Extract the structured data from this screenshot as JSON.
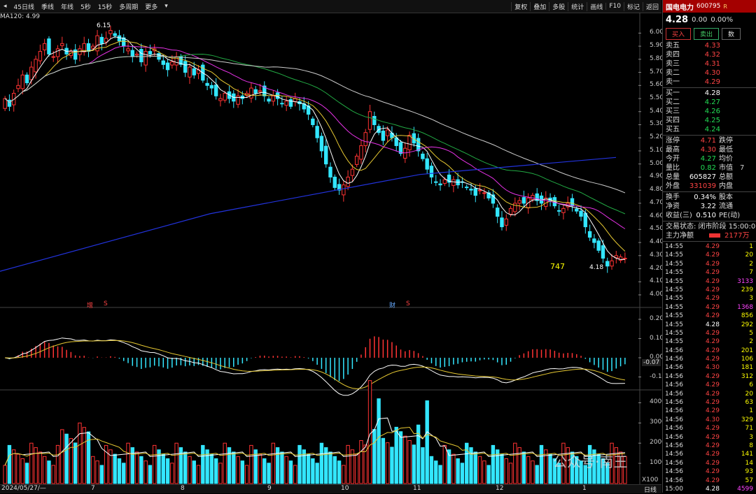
{
  "toolbar": {
    "tabs": [
      "45日线",
      "季线",
      "年线",
      "5秒",
      "15秒",
      "多周期",
      "更多"
    ],
    "tools": [
      "复权",
      "叠加",
      "多股",
      "统计",
      "画线",
      "F10",
      "标记",
      "返回"
    ],
    "nav_icons": [
      "back-icon",
      "forward-icon"
    ]
  },
  "ma_legend": {
    "ma120": "MA120: 4.99"
  },
  "chart_data": [
    {
      "type": "candlestick",
      "title": "",
      "y_ticks": [
        "6.00",
        "5.90",
        "5.80",
        "5.70",
        "5.60",
        "5.50",
        "5.40",
        "5.30",
        "5.20",
        "5.10",
        "5.00",
        "4.90",
        "4.80",
        "4.70",
        "4.60",
        "4.50",
        "4.40",
        "4.30",
        "4.20",
        "4.10",
        "4.00"
      ],
      "ylim": [
        4.0,
        6.05
      ],
      "x_ticks": [
        "7",
        "8",
        "9",
        "10",
        "11",
        "12",
        "1"
      ],
      "start_date": "2024/05/27/—",
      "annotations": {
        "high": "6.15",
        "low": "4.18",
        "count": "747",
        "tag_a": "增",
        "tag_b": "财",
        "tag_c": "S",
        "tag_d": "S"
      },
      "closes": [
        5.5,
        5.44,
        5.54,
        5.6,
        5.68,
        5.62,
        5.74,
        5.8,
        5.86,
        5.92,
        5.84,
        5.82,
        5.88,
        5.92,
        5.84,
        5.86,
        5.8,
        5.88,
        5.92,
        5.86,
        5.9,
        5.98,
        5.92,
        5.96,
        6.02,
        5.98,
        5.94,
        5.9,
        5.88,
        5.82,
        5.84,
        5.78,
        5.86,
        5.84,
        5.88,
        5.8,
        5.76,
        5.72,
        5.78,
        5.82,
        5.76,
        5.7,
        5.74,
        5.68,
        5.72,
        5.64,
        5.6,
        5.58,
        5.52,
        5.5,
        5.54,
        5.5,
        5.48,
        5.52,
        5.5,
        5.54,
        5.58,
        5.54,
        5.56,
        5.52,
        5.48,
        5.52,
        5.5,
        5.46,
        5.48,
        5.44,
        5.5,
        5.46,
        5.42,
        5.38,
        5.3,
        5.2,
        5.1,
        5.0,
        4.9,
        4.82,
        4.8,
        4.84,
        4.9,
        4.96,
        5.06,
        5.14,
        5.24,
        5.4,
        5.3,
        5.24,
        5.18,
        5.26,
        5.2,
        5.14,
        5.08,
        5.12,
        5.22,
        5.16,
        5.1,
        5.04,
        4.96,
        4.9,
        4.86,
        4.84,
        4.88,
        4.86,
        4.88,
        4.84,
        4.86,
        4.82,
        4.8,
        4.76,
        4.8,
        4.78,
        4.74,
        4.7,
        4.6,
        4.52,
        4.58,
        4.66,
        4.7,
        4.72,
        4.7,
        4.74,
        4.76,
        4.72,
        4.7,
        4.74,
        4.72,
        4.68,
        4.64,
        4.66,
        4.7,
        4.68,
        4.64,
        4.6,
        4.52,
        4.44,
        4.4,
        4.34,
        4.28,
        4.22,
        4.26,
        4.3,
        4.29,
        4.28
      ]
    },
    {
      "type": "macd",
      "y_ticks": [
        "0.20",
        "0.10",
        "0.00",
        "-0.10",
        "-0.07"
      ],
      "ylim": [
        -0.16,
        0.24
      ],
      "current_value": "-0.07"
    },
    {
      "type": "bar",
      "title": "",
      "y_ticks": [
        "40000",
        "30000",
        "20000",
        "10000"
      ],
      "unit": "X100",
      "ylim": [
        0,
        45000
      ]
    }
  ],
  "stock": {
    "name": "国电电力",
    "code": "600795",
    "flag": "R",
    "price": "4.28",
    "change": "0.00",
    "change_pct": "0.00%",
    "buy_btn": "买入",
    "sell_btn": "卖出",
    "other_btn": "数"
  },
  "sell_orders": [
    {
      "label": "卖五",
      "price": "4.33"
    },
    {
      "label": "卖四",
      "price": "4.32"
    },
    {
      "label": "卖三",
      "price": "4.31"
    },
    {
      "label": "卖二",
      "price": "4.30"
    },
    {
      "label": "卖一",
      "price": "4.29"
    }
  ],
  "buy_orders": [
    {
      "label": "买一",
      "price": "4.28"
    },
    {
      "label": "买二",
      "price": "4.27"
    },
    {
      "label": "买三",
      "price": "4.26"
    },
    {
      "label": "买四",
      "price": "4.25"
    },
    {
      "label": "买五",
      "price": "4.24"
    }
  ],
  "stats": [
    {
      "k": "涨停",
      "v": "4.71",
      "k2": "跌停",
      "v2": ""
    },
    {
      "k": "最高",
      "v": "4.30",
      "k2": "最低",
      "v2": ""
    },
    {
      "k": "今开",
      "v": "4.27",
      "k2": "均价",
      "v2": ""
    },
    {
      "k": "量比",
      "v": "0.82",
      "k2": "市值",
      "v2": "7"
    },
    {
      "k": "总量",
      "v": "605827",
      "k2": "总额",
      "v2": ""
    },
    {
      "k": "外盘",
      "v": "331039",
      "k2": "内盘",
      "v2": ""
    }
  ],
  "stats2": [
    {
      "k": "换手",
      "v": "0.34%",
      "k2": "股本"
    },
    {
      "k": "净资",
      "v": "3.22",
      "k2": "流通"
    },
    {
      "k": "收益(三)",
      "v": "0.510",
      "k2": "PE(动)"
    }
  ],
  "status": "交易状态: 闭市阶段 15:00:0",
  "main_flow": {
    "label": "主力净额",
    "value": "2177万"
  },
  "ticks": [
    {
      "t": "14:55",
      "p": "4.29",
      "v": "1"
    },
    {
      "t": "14:55",
      "p": "4.29",
      "v": "20"
    },
    {
      "t": "14:55",
      "p": "4.29",
      "v": "2"
    },
    {
      "t": "14:55",
      "p": "4.29",
      "v": "7"
    },
    {
      "t": "14:55",
      "p": "4.29",
      "v": "3133"
    },
    {
      "t": "14:55",
      "p": "4.29",
      "v": "239"
    },
    {
      "t": "14:55",
      "p": "4.29",
      "v": "3"
    },
    {
      "t": "14:55",
      "p": "4.29",
      "v": "1368"
    },
    {
      "t": "14:55",
      "p": "4.29",
      "v": "856"
    },
    {
      "t": "14:55",
      "p": "4.28",
      "v": "292"
    },
    {
      "t": "14:55",
      "p": "4.29",
      "v": "5"
    },
    {
      "t": "14:55",
      "p": "4.29",
      "v": "2"
    },
    {
      "t": "14:56",
      "p": "4.29",
      "v": "201"
    },
    {
      "t": "14:56",
      "p": "4.29",
      "v": "106"
    },
    {
      "t": "14:56",
      "p": "4.30",
      "v": "181"
    },
    {
      "t": "14:56",
      "p": "4.29",
      "v": "312"
    },
    {
      "t": "14:56",
      "p": "4.29",
      "v": "6"
    },
    {
      "t": "14:56",
      "p": "4.29",
      "v": "20"
    },
    {
      "t": "14:56",
      "p": "4.29",
      "v": "63"
    },
    {
      "t": "14:56",
      "p": "4.29",
      "v": "1"
    },
    {
      "t": "14:56",
      "p": "4.30",
      "v": "329"
    },
    {
      "t": "14:56",
      "p": "4.29",
      "v": "71"
    },
    {
      "t": "14:56",
      "p": "4.29",
      "v": "3"
    },
    {
      "t": "14:56",
      "p": "4.29",
      "v": "8"
    },
    {
      "t": "14:56",
      "p": "4.29",
      "v": "141"
    },
    {
      "t": "14:56",
      "p": "4.29",
      "v": "14"
    },
    {
      "t": "14:56",
      "p": "4.29",
      "v": "93"
    },
    {
      "t": "14:56",
      "p": "4.29",
      "v": "57"
    },
    {
      "t": "15:00",
      "p": "4.28",
      "v": "4599"
    }
  ],
  "watermark": "公众号·南王",
  "period_label": "日线"
}
